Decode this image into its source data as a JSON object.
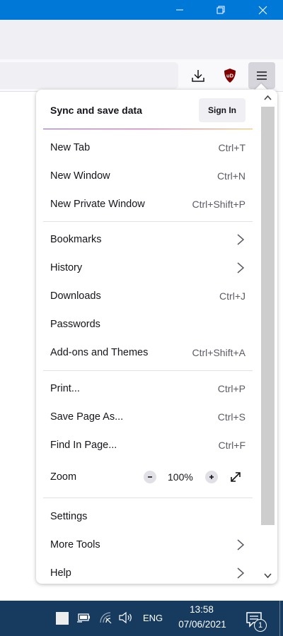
{
  "window": {
    "controls": [
      "minimize-icon",
      "restore-icon",
      "close-icon"
    ]
  },
  "toolbar": {
    "icons": [
      "download-icon",
      "ublock-origin-icon",
      "hamburger-menu-icon"
    ],
    "ublock_badge": "uD"
  },
  "app_menu": {
    "sync_label": "Sync and save data",
    "sign_in_label": "Sign In",
    "items": {
      "new_tab": {
        "label": "New Tab",
        "shortcut": "Ctrl+T"
      },
      "new_window": {
        "label": "New Window",
        "shortcut": "Ctrl+N"
      },
      "new_private_window": {
        "label": "New Private Window",
        "shortcut": "Ctrl+Shift+P"
      },
      "bookmarks": {
        "label": "Bookmarks"
      },
      "history": {
        "label": "History"
      },
      "downloads": {
        "label": "Downloads",
        "shortcut": "Ctrl+J"
      },
      "passwords": {
        "label": "Passwords"
      },
      "addons": {
        "label": "Add-ons and Themes",
        "shortcut": "Ctrl+Shift+A"
      },
      "print": {
        "label": "Print...",
        "shortcut": "Ctrl+P"
      },
      "save_page": {
        "label": "Save Page As...",
        "shortcut": "Ctrl+S"
      },
      "find_in_page": {
        "label": "Find In Page...",
        "shortcut": "Ctrl+F"
      },
      "zoom": {
        "label": "Zoom",
        "value": "100%"
      },
      "settings": {
        "label": "Settings"
      },
      "more_tools": {
        "label": "More Tools"
      },
      "help": {
        "label": "Help"
      }
    }
  },
  "taskbar": {
    "language": "ENG",
    "time": "13:58",
    "date": "07/06/2021",
    "notification_count": "1"
  },
  "colors": {
    "titlebar": "#0078d7",
    "taskbar": "#163b5f",
    "ublock_red": "#800000",
    "menu_button_active": "#d5d5db"
  }
}
